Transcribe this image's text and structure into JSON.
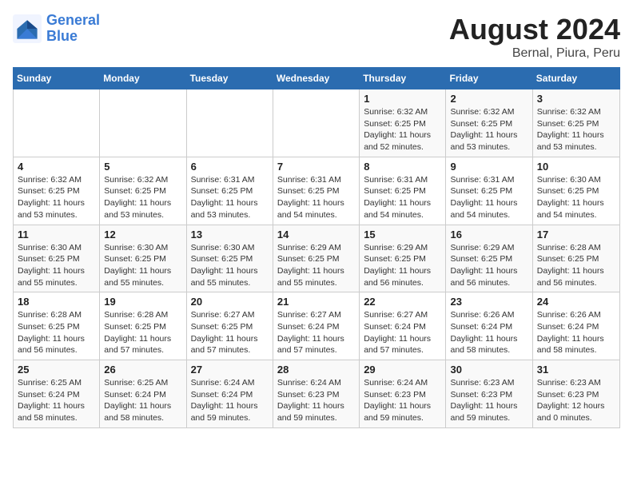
{
  "logo": {
    "line1": "General",
    "line2": "Blue"
  },
  "title": "August 2024",
  "subtitle": "Bernal, Piura, Peru",
  "days_header": [
    "Sunday",
    "Monday",
    "Tuesday",
    "Wednesday",
    "Thursday",
    "Friday",
    "Saturday"
  ],
  "weeks": [
    [
      {
        "day": "",
        "info": ""
      },
      {
        "day": "",
        "info": ""
      },
      {
        "day": "",
        "info": ""
      },
      {
        "day": "",
        "info": ""
      },
      {
        "day": "1",
        "info": "Sunrise: 6:32 AM\nSunset: 6:25 PM\nDaylight: 11 hours\nand 52 minutes."
      },
      {
        "day": "2",
        "info": "Sunrise: 6:32 AM\nSunset: 6:25 PM\nDaylight: 11 hours\nand 53 minutes."
      },
      {
        "day": "3",
        "info": "Sunrise: 6:32 AM\nSunset: 6:25 PM\nDaylight: 11 hours\nand 53 minutes."
      }
    ],
    [
      {
        "day": "4",
        "info": "Sunrise: 6:32 AM\nSunset: 6:25 PM\nDaylight: 11 hours\nand 53 minutes."
      },
      {
        "day": "5",
        "info": "Sunrise: 6:32 AM\nSunset: 6:25 PM\nDaylight: 11 hours\nand 53 minutes."
      },
      {
        "day": "6",
        "info": "Sunrise: 6:31 AM\nSunset: 6:25 PM\nDaylight: 11 hours\nand 53 minutes."
      },
      {
        "day": "7",
        "info": "Sunrise: 6:31 AM\nSunset: 6:25 PM\nDaylight: 11 hours\nand 54 minutes."
      },
      {
        "day": "8",
        "info": "Sunrise: 6:31 AM\nSunset: 6:25 PM\nDaylight: 11 hours\nand 54 minutes."
      },
      {
        "day": "9",
        "info": "Sunrise: 6:31 AM\nSunset: 6:25 PM\nDaylight: 11 hours\nand 54 minutes."
      },
      {
        "day": "10",
        "info": "Sunrise: 6:30 AM\nSunset: 6:25 PM\nDaylight: 11 hours\nand 54 minutes."
      }
    ],
    [
      {
        "day": "11",
        "info": "Sunrise: 6:30 AM\nSunset: 6:25 PM\nDaylight: 11 hours\nand 55 minutes."
      },
      {
        "day": "12",
        "info": "Sunrise: 6:30 AM\nSunset: 6:25 PM\nDaylight: 11 hours\nand 55 minutes."
      },
      {
        "day": "13",
        "info": "Sunrise: 6:30 AM\nSunset: 6:25 PM\nDaylight: 11 hours\nand 55 minutes."
      },
      {
        "day": "14",
        "info": "Sunrise: 6:29 AM\nSunset: 6:25 PM\nDaylight: 11 hours\nand 55 minutes."
      },
      {
        "day": "15",
        "info": "Sunrise: 6:29 AM\nSunset: 6:25 PM\nDaylight: 11 hours\nand 56 minutes."
      },
      {
        "day": "16",
        "info": "Sunrise: 6:29 AM\nSunset: 6:25 PM\nDaylight: 11 hours\nand 56 minutes."
      },
      {
        "day": "17",
        "info": "Sunrise: 6:28 AM\nSunset: 6:25 PM\nDaylight: 11 hours\nand 56 minutes."
      }
    ],
    [
      {
        "day": "18",
        "info": "Sunrise: 6:28 AM\nSunset: 6:25 PM\nDaylight: 11 hours\nand 56 minutes."
      },
      {
        "day": "19",
        "info": "Sunrise: 6:28 AM\nSunset: 6:25 PM\nDaylight: 11 hours\nand 57 minutes."
      },
      {
        "day": "20",
        "info": "Sunrise: 6:27 AM\nSunset: 6:25 PM\nDaylight: 11 hours\nand 57 minutes."
      },
      {
        "day": "21",
        "info": "Sunrise: 6:27 AM\nSunset: 6:24 PM\nDaylight: 11 hours\nand 57 minutes."
      },
      {
        "day": "22",
        "info": "Sunrise: 6:27 AM\nSunset: 6:24 PM\nDaylight: 11 hours\nand 57 minutes."
      },
      {
        "day": "23",
        "info": "Sunrise: 6:26 AM\nSunset: 6:24 PM\nDaylight: 11 hours\nand 58 minutes."
      },
      {
        "day": "24",
        "info": "Sunrise: 6:26 AM\nSunset: 6:24 PM\nDaylight: 11 hours\nand 58 minutes."
      }
    ],
    [
      {
        "day": "25",
        "info": "Sunrise: 6:25 AM\nSunset: 6:24 PM\nDaylight: 11 hours\nand 58 minutes."
      },
      {
        "day": "26",
        "info": "Sunrise: 6:25 AM\nSunset: 6:24 PM\nDaylight: 11 hours\nand 58 minutes."
      },
      {
        "day": "27",
        "info": "Sunrise: 6:24 AM\nSunset: 6:24 PM\nDaylight: 11 hours\nand 59 minutes."
      },
      {
        "day": "28",
        "info": "Sunrise: 6:24 AM\nSunset: 6:23 PM\nDaylight: 11 hours\nand 59 minutes."
      },
      {
        "day": "29",
        "info": "Sunrise: 6:24 AM\nSunset: 6:23 PM\nDaylight: 11 hours\nand 59 minutes."
      },
      {
        "day": "30",
        "info": "Sunrise: 6:23 AM\nSunset: 6:23 PM\nDaylight: 11 hours\nand 59 minutes."
      },
      {
        "day": "31",
        "info": "Sunrise: 6:23 AM\nSunset: 6:23 PM\nDaylight: 12 hours\nand 0 minutes."
      }
    ]
  ]
}
